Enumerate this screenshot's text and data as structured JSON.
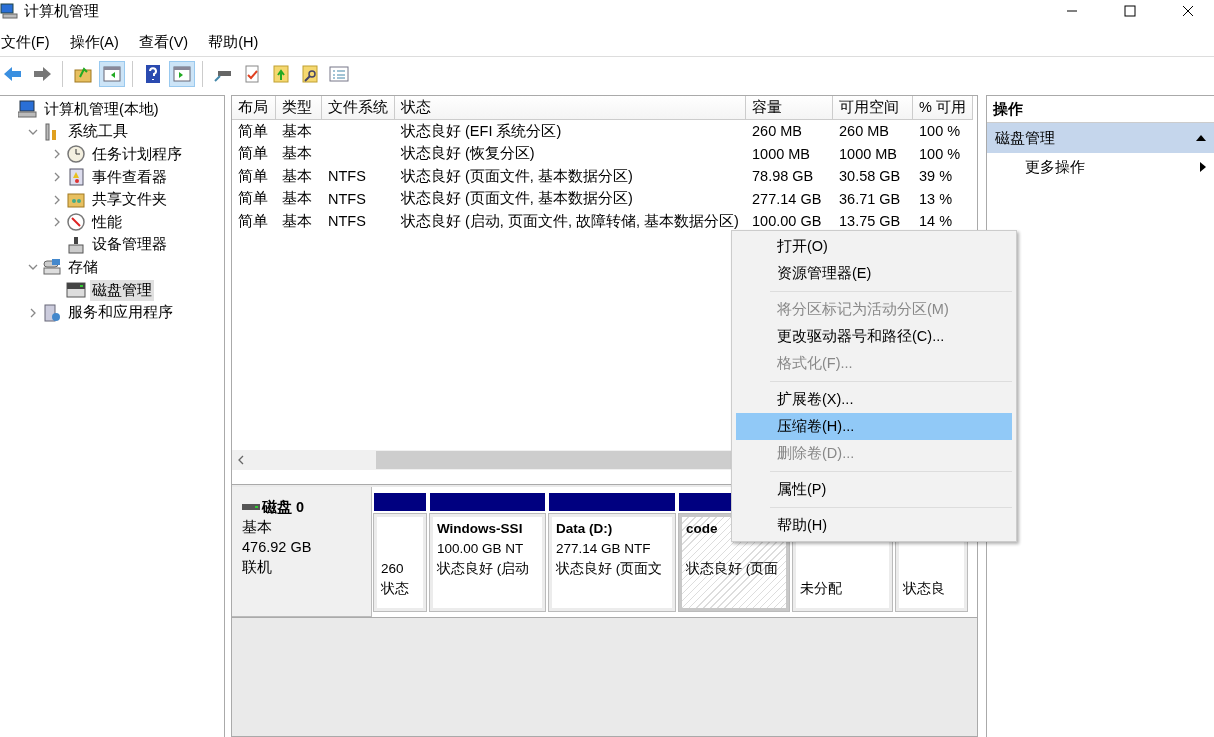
{
  "window": {
    "title": "计算机管理"
  },
  "menu_bar": [
    "文件(F)",
    "操作(A)",
    "查看(V)",
    "帮助(H)"
  ],
  "toolbar": [
    {
      "kind": "back",
      "pressed": false
    },
    {
      "kind": "forward",
      "pressed": false
    },
    {
      "kind": "sep"
    },
    {
      "kind": "up",
      "pressed": false
    },
    {
      "kind": "tree",
      "pressed": true
    },
    {
      "kind": "sep"
    },
    {
      "kind": "help",
      "pressed": false
    },
    {
      "kind": "pane",
      "pressed": true
    },
    {
      "kind": "sep"
    },
    {
      "kind": "connect",
      "pressed": false
    },
    {
      "kind": "check",
      "pressed": false
    },
    {
      "kind": "export",
      "pressed": false
    },
    {
      "kind": "find",
      "pressed": false
    },
    {
      "kind": "list",
      "pressed": false
    }
  ],
  "tree": [
    {
      "label": "计算机管理(本地)",
      "kind": "computer",
      "selected": false,
      "children": [
        {
          "label": "系统工具",
          "kind": "tools",
          "expanded": true,
          "selected": false,
          "children": [
            {
              "label": "任务计划程序",
              "kind": "clock",
              "expanded": false,
              "selected": false
            },
            {
              "label": "事件查看器",
              "kind": "event",
              "expanded": false,
              "selected": false
            },
            {
              "label": "共享文件夹",
              "kind": "share",
              "expanded": false,
              "selected": false
            },
            {
              "label": "性能",
              "kind": "perf",
              "expanded": false,
              "selected": false
            },
            {
              "label": "设备管理器",
              "kind": "device",
              "selected": false
            }
          ]
        },
        {
          "label": "存储",
          "kind": "storage",
          "expanded": true,
          "selected": false,
          "children": [
            {
              "label": "磁盘管理",
              "kind": "disk",
              "selected": true
            }
          ]
        },
        {
          "label": "服务和应用程序",
          "kind": "services",
          "expanded": false,
          "selected": false
        }
      ]
    }
  ],
  "table": {
    "columns": [
      "布局",
      "类型",
      "文件系统",
      "状态",
      "容量",
      "可用空间",
      "% 可用"
    ],
    "rows": [
      [
        "简单",
        "基本",
        "",
        "状态良好 (EFI 系统分区)",
        "260 MB",
        "260 MB",
        "100 %"
      ],
      [
        "简单",
        "基本",
        "",
        "状态良好 (恢复分区)",
        "1000 MB",
        "1000 MB",
        "100 %"
      ],
      [
        "简单",
        "基本",
        "NTFS",
        "状态良好 (页面文件, 基本数据分区)",
        "78.98 GB",
        "30.58 GB",
        "39 %"
      ],
      [
        "简单",
        "基本",
        "NTFS",
        "状态良好 (页面文件, 基本数据分区)",
        "277.14 GB",
        "36.71 GB",
        "13 %"
      ],
      [
        "简单",
        "基本",
        "NTFS",
        "状态良好 (启动, 页面文件, 故障转储, 基本数据分区)",
        "100.00 GB",
        "13.75 GB",
        "14 %"
      ]
    ]
  },
  "disk": {
    "name": "磁盘 0",
    "type": "基本",
    "size": "476.92 GB",
    "status": "联机",
    "partitions": [
      {
        "lines": [
          "260",
          "状态"
        ],
        "selected": false
      },
      {
        "title": "Windows-SSI",
        "lines": [
          "100.00 GB NT",
          "状态良好 (启动"
        ],
        "selected": false
      },
      {
        "title": "Data  (D:)",
        "lines": [
          "277.14 GB NTF",
          "状态良好 (页面文"
        ],
        "selected": false
      },
      {
        "title": "code",
        "lines": [
          "状态良好 (页面"
        ],
        "selected": true
      },
      {
        "lines": [
          "未分配"
        ],
        "selected": false,
        "header": false
      },
      {
        "lines": [
          "状态良"
        ],
        "selected": false,
        "header": false
      }
    ]
  },
  "actions": {
    "title": "操作",
    "section": "磁盘管理",
    "items": [
      "更多操作"
    ]
  },
  "context_menu": [
    {
      "kind": "item",
      "label": "打开(O)",
      "disabled": false,
      "selected": false
    },
    {
      "kind": "item",
      "label": "资源管理器(E)",
      "disabled": false,
      "selected": false
    },
    {
      "kind": "separator"
    },
    {
      "kind": "item",
      "label": "将分区标记为活动分区(M)",
      "disabled": true,
      "selected": false
    },
    {
      "kind": "item",
      "label": "更改驱动器号和路径(C)...",
      "disabled": false,
      "selected": false
    },
    {
      "kind": "item",
      "label": "格式化(F)...",
      "disabled": true,
      "selected": false
    },
    {
      "kind": "separator"
    },
    {
      "kind": "item",
      "label": "扩展卷(X)...",
      "disabled": false,
      "selected": false
    },
    {
      "kind": "item",
      "label": "压缩卷(H)...",
      "disabled": false,
      "selected": true
    },
    {
      "kind": "item",
      "label": "删除卷(D)...",
      "disabled": true,
      "selected": false
    },
    {
      "kind": "separator"
    },
    {
      "kind": "item",
      "label": "属性(P)",
      "disabled": false,
      "selected": false
    },
    {
      "kind": "separator"
    },
    {
      "kind": "item",
      "label": "帮助(H)",
      "disabled": false,
      "selected": false
    }
  ]
}
